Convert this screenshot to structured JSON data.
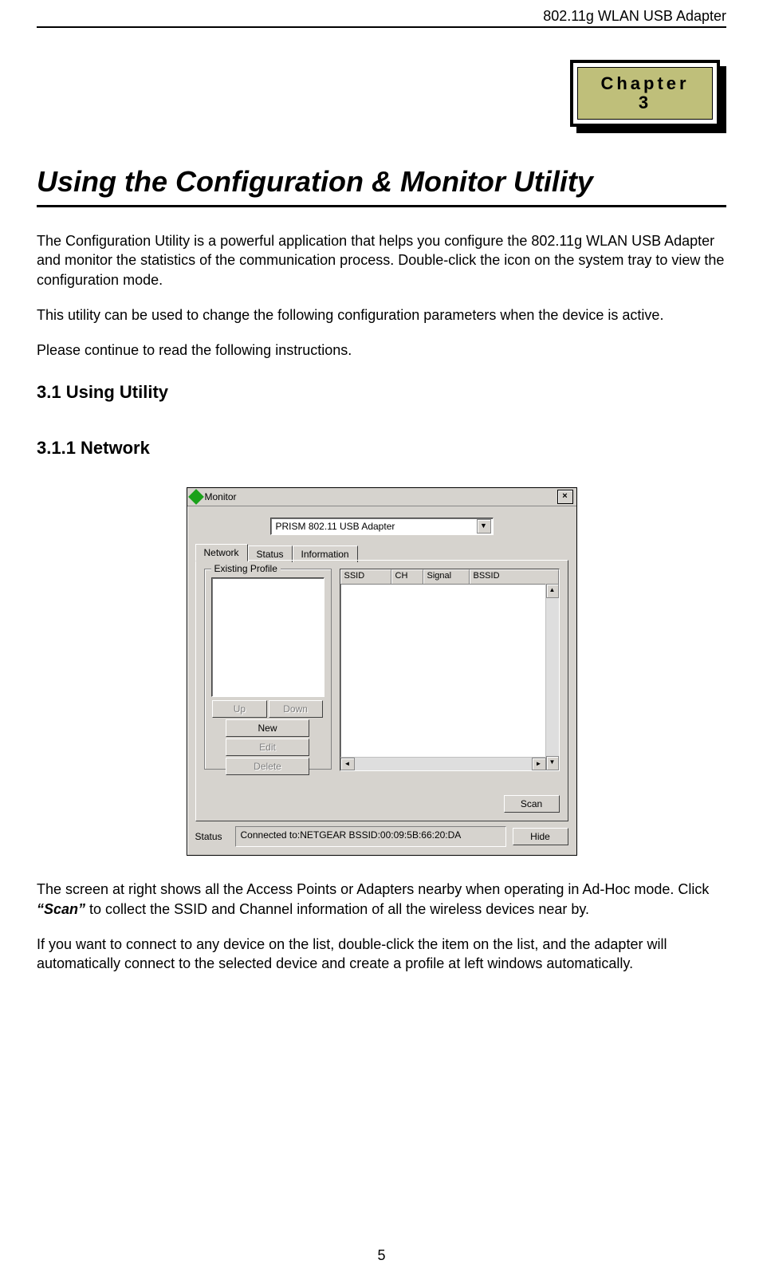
{
  "header": {
    "product": "802.11g WLAN USB Adapter"
  },
  "chapter": {
    "label": "Chapter",
    "number": "3"
  },
  "title": "Using the Configuration & Monitor Utility",
  "paragraphs": {
    "p1": "The Configuration Utility is a powerful application that helps you configure the 802.11g WLAN USB Adapter and monitor the statistics of the communication process. Double-click the icon on the system tray to view the configuration mode.",
    "p2": "This utility can be used to change the following configuration parameters when the device is active.",
    "p3": "Please continue to read the following instructions.",
    "p4_pre": "The screen at right shows all the Access Points or Adapters nearby when operating in Ad-Hoc mode. Click ",
    "p4_scan": "“Scan”",
    "p4_post": " to collect the SSID and Channel information of all the wireless devices near by.",
    "p5": "If you want to connect to any device on the list, double-click the item on the list, and the adapter will automatically connect to the selected device and create a profile at left windows automatically."
  },
  "sections": {
    "s1": "3.1 Using Utility",
    "s2": "3.1.1 Network"
  },
  "monitor": {
    "title": "Monitor",
    "close": "×",
    "adapter_selected": "PRISM 802.11 USB Adapter",
    "tabs": {
      "network": "Network",
      "status": "Status",
      "information": "Information"
    },
    "profile": {
      "group_label": "Existing Profile",
      "up": "Up",
      "down": "Down",
      "new": "New",
      "edit": "Edit",
      "delete": "Delete"
    },
    "ap_columns": {
      "ssid": "SSID",
      "ch": "CH",
      "signal": "Signal",
      "bssid": "BSSID"
    },
    "scan": "Scan",
    "status_label": "Status",
    "status_value": "Connected to:NETGEAR    BSSID:00:09:5B:66:20:DA",
    "hide": "Hide"
  },
  "page_number": "5"
}
